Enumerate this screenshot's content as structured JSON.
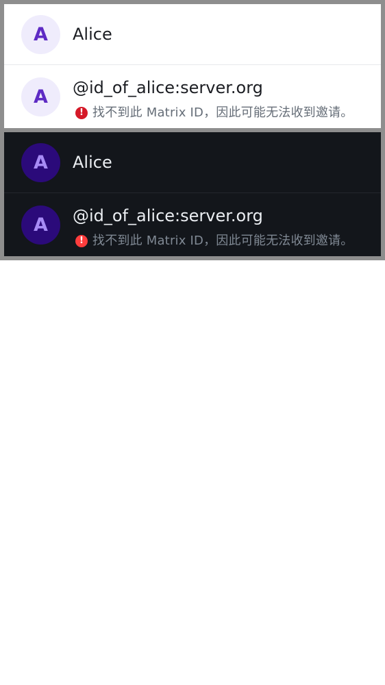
{
  "light": {
    "contact": {
      "avatar_letter": "A",
      "name": "Alice"
    },
    "invite": {
      "avatar_letter": "A",
      "matrix_id": "@id_of_alice:server.org",
      "warning_icon": "!",
      "warning": "找不到此 Matrix ID，因此可能无法收到邀请。"
    }
  },
  "dark": {
    "contact": {
      "avatar_letter": "A",
      "name": "Alice"
    },
    "invite": {
      "avatar_letter": "A",
      "matrix_id": "@id_of_alice:server.org",
      "warning_icon": "!",
      "warning": "找不到此 Matrix ID，因此可能无法收到邀请。"
    }
  },
  "colors": {
    "light_avatar_bg": "#efecfc",
    "light_avatar_fg": "#5e2bc4",
    "dark_avatar_bg": "#2b0a7a",
    "dark_avatar_fg": "#a78bf5",
    "light_error": "#d51928",
    "dark_error": "#ff3d3d",
    "dark_background": "#13161b"
  }
}
